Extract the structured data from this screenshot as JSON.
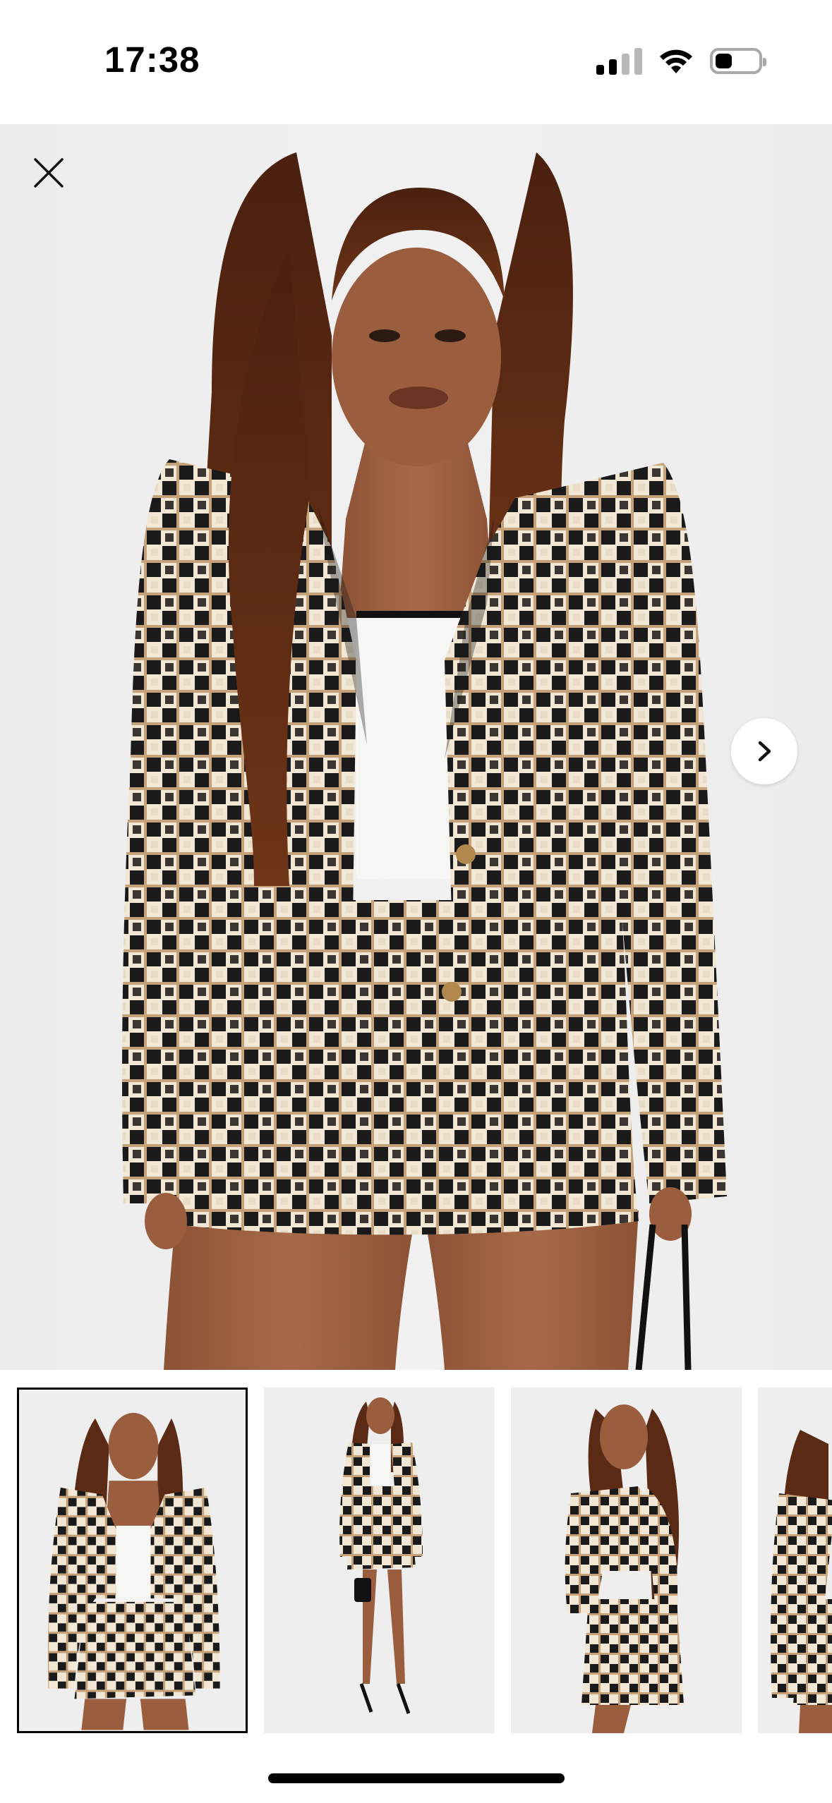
{
  "status_bar": {
    "time": "17:38",
    "icons": [
      "cellular-signal-icon",
      "wifi-icon",
      "battery-icon"
    ]
  },
  "gallery": {
    "main_image": "model-in-black-cream-tweed-cropped-blazer-and-mini-skirt",
    "close_icon": "close-icon",
    "next_icon": "chevron-right-icon",
    "thumbnails": [
      {
        "name": "front-view",
        "selected": true
      },
      {
        "name": "full-length-front-view",
        "selected": false
      },
      {
        "name": "side-view",
        "selected": false
      },
      {
        "name": "back-view",
        "selected": false
      }
    ]
  },
  "colors": {
    "tweed_black": "#1b1b1b",
    "tweed_cream": "#f3ead9",
    "tweed_tan": "#c8a57b",
    "backdrop": "#eeeeee",
    "skin": "#9a5f3e",
    "hair": "#5a2a15"
  }
}
